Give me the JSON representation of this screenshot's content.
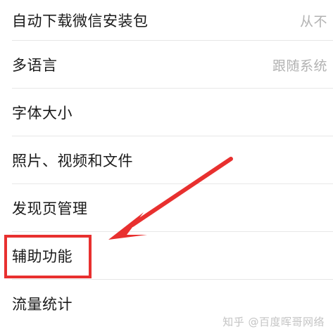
{
  "settings": {
    "items": [
      {
        "label": "自动下载微信安装包",
        "value": "从不"
      },
      {
        "label": "多语言",
        "value": "跟随系统"
      },
      {
        "label": "字体大小",
        "value": ""
      },
      {
        "label": "照片、视频和文件",
        "value": ""
      },
      {
        "label": "发现页管理",
        "value": ""
      },
      {
        "label": "辅助功能",
        "value": ""
      },
      {
        "label": "流量统计",
        "value": ""
      }
    ]
  },
  "annotation": {
    "box_color": "#e8302f",
    "arrow_color": "#e8302f",
    "highlighted_item": "辅助功能"
  },
  "watermark": "知乎 @百度晖哥网络"
}
